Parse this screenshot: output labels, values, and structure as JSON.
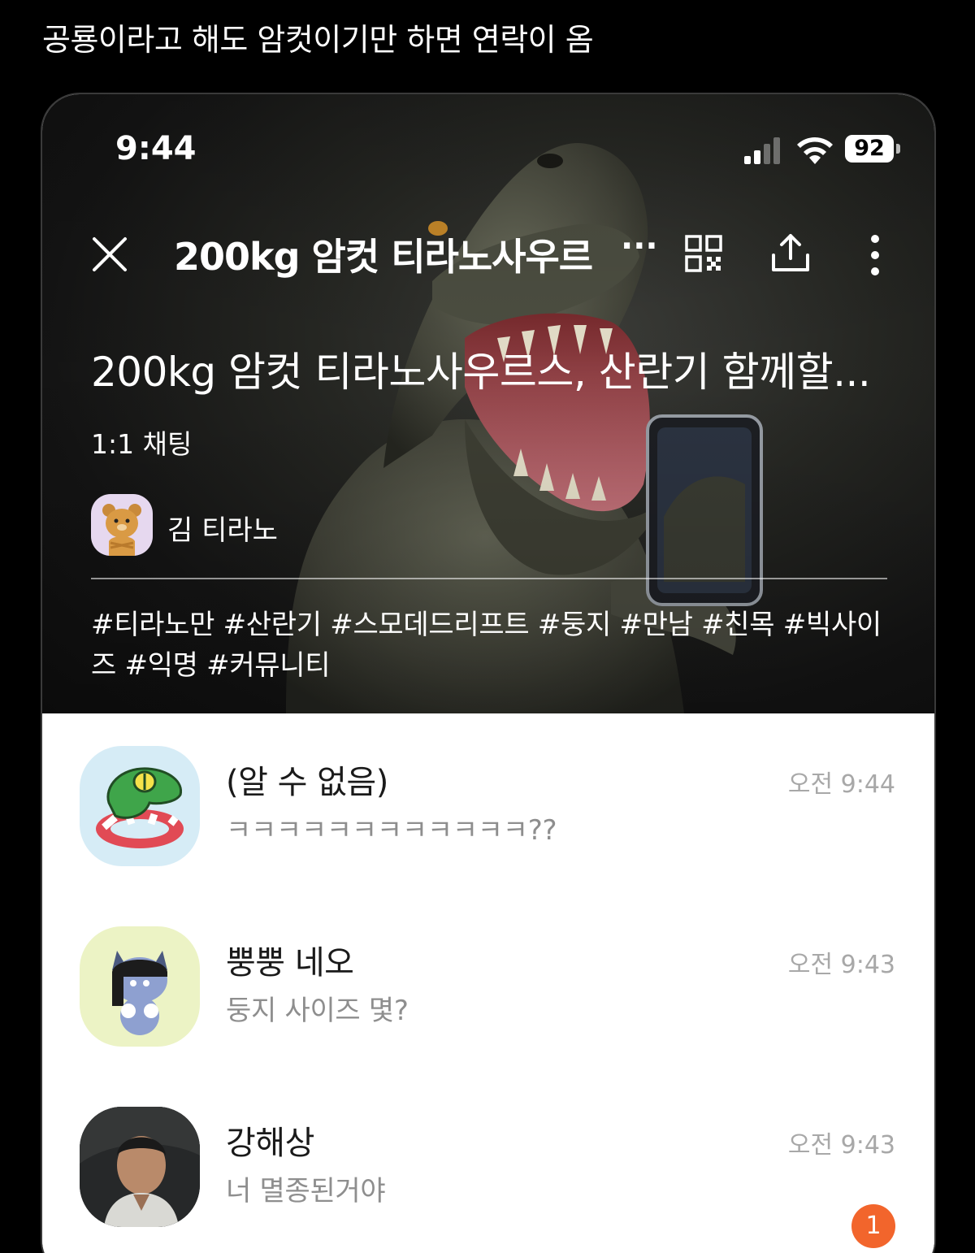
{
  "post": {
    "caption": "공룡이라고 해도 암컷이기만 하면 연락이 옴"
  },
  "status_bar": {
    "time": "9:44",
    "battery": "92"
  },
  "nav": {
    "title": "200kg 암컷 티라노사우르",
    "ellipsis": "···"
  },
  "room": {
    "title": "200kg 암컷 티라노사우르스, 산란기 함께할...",
    "type": "1:1 채팅",
    "host_name": "김 티라노",
    "hashtags": "#티라노만 #산란기 #스모데드리프트 #둥지 #만남 #친목 #빅사이즈 #익명 #커뮤니티"
  },
  "chats": [
    {
      "name": "(알 수 없음)",
      "preview": "ㅋㅋㅋㅋㅋㅋㅋㅋㅋㅋㅋㅋ??",
      "time": "오전 9:44",
      "unread": null
    },
    {
      "name": "뿡뿡 네오",
      "preview": "둥지 사이즈 몇?",
      "time": "오전 9:43",
      "unread": null
    },
    {
      "name": "강해상",
      "preview": "너 멸종된거야",
      "time": "오전 9:43",
      "unread": "1"
    }
  ],
  "colors": {
    "badge": "#f2652c",
    "timestamp": "#a8a8a8",
    "preview": "#8e8e8e"
  },
  "icons": {
    "close": "close-icon",
    "qr": "qr-code-icon",
    "share": "share-icon",
    "more": "more-vertical-icon",
    "signal": "signal-icon",
    "wifi": "wifi-icon"
  }
}
